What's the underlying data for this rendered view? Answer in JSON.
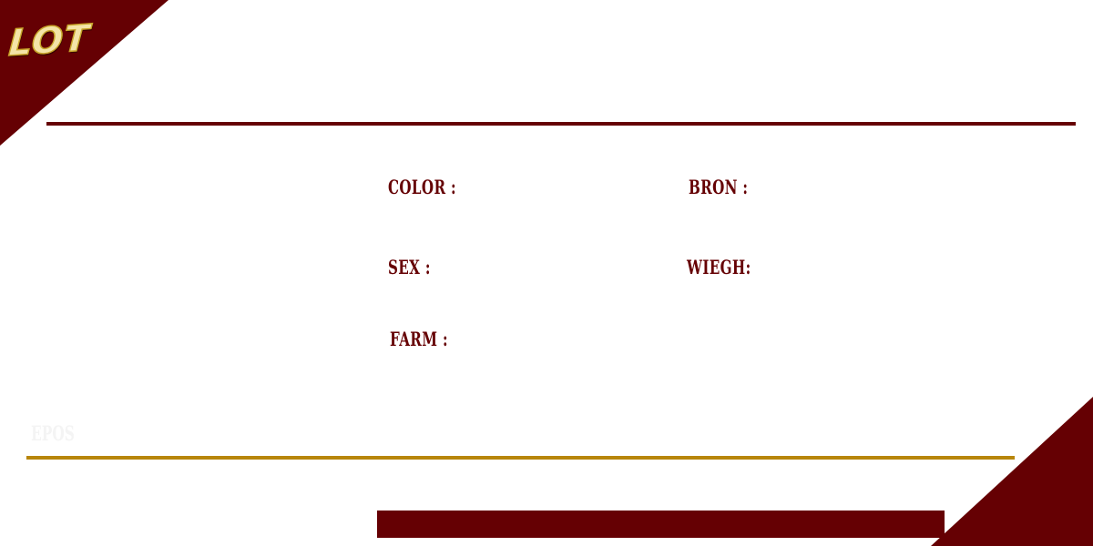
{
  "brand": {
    "lot_label": "LOT",
    "primary_color": "#650003",
    "accent_color": "#b8860b",
    "lot_text_color": "#f4e4a8"
  },
  "fields": {
    "color_label": "COLOR :",
    "bron_label": "BRON :",
    "sex_label": "SEX :",
    "wiegh_label": "WIEGH:",
    "farm_label": "FARM :"
  },
  "watermark": {
    "text": "EPOS"
  }
}
